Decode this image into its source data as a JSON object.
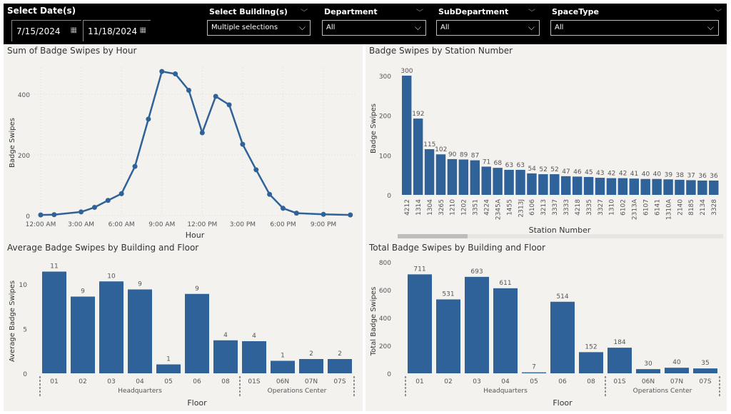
{
  "filters": {
    "date_label": "Select Date(s)",
    "start_date": "7/15/2024",
    "end_date": "11/18/2024",
    "building": {
      "label": "Select Building(s)",
      "value": "Multiple selections"
    },
    "department": {
      "label": "Department",
      "value": "All"
    },
    "subdepartment": {
      "label": "SubDepartment",
      "value": "All"
    },
    "spacetype": {
      "label": "SpaceType",
      "value": "All"
    }
  },
  "colors": {
    "bar": "#2f6298",
    "line": "#2f6298",
    "panel_bg": "#f4f2ee",
    "filter_bg": "#000000"
  },
  "chart_data": [
    {
      "type": "line",
      "title": "Sum of Badge Swipes by Hour",
      "xlabel": "Hour",
      "ylabel": "Badge Swipes",
      "x_ticks": [
        "12:00 AM",
        "3:00 AM",
        "6:00 AM",
        "9:00 AM",
        "12:00 PM",
        "3:00 PM",
        "6:00 PM",
        "9:00 PM"
      ],
      "y_ticks": [
        0,
        200,
        400
      ],
      "ylim": [
        0,
        480
      ],
      "grid": true,
      "x": [
        0,
        1,
        3,
        4,
        5,
        6,
        7,
        8,
        9,
        10,
        11,
        12,
        13,
        14,
        15,
        16,
        17,
        18,
        19,
        21,
        23
      ],
      "values": [
        2,
        3,
        12,
        27,
        50,
        72,
        162,
        318,
        475,
        467,
        413,
        273,
        393,
        365,
        235,
        151,
        70,
        24,
        8,
        4,
        2
      ]
    },
    {
      "type": "bar",
      "title": "Badge Swipes by Station Number",
      "xlabel": "Station Number",
      "ylabel": "Badge Swipes",
      "y_ticks": [
        0,
        100,
        200,
        300
      ],
      "ylim": [
        0,
        310
      ],
      "categories": [
        "4212",
        "1314",
        "1304",
        "3265",
        "1210",
        "1202",
        "3351",
        "4224",
        "2345A",
        "1455",
        "2313J",
        "6106",
        "3213",
        "3337",
        "3333",
        "4218",
        "3335",
        "3327",
        "1310",
        "6102",
        "2313A",
        "6107",
        "6141",
        "1310A",
        "2140",
        "8185",
        "2134",
        "3328"
      ],
      "values": [
        300,
        192,
        115,
        102,
        90,
        89,
        87,
        71,
        68,
        63,
        63,
        54,
        52,
        52,
        47,
        46,
        45,
        43,
        42,
        42,
        41,
        40,
        40,
        39,
        38,
        37,
        36,
        36
      ]
    },
    {
      "type": "bar",
      "title": "Average Badge Swipes by Building and Floor",
      "xlabel": "Floor",
      "ylabel": "Average Badge Swipes",
      "y_ticks": [
        0,
        5,
        10
      ],
      "ylim": [
        0,
        12.5
      ],
      "categories": [
        "01",
        "02",
        "03",
        "04",
        "05",
        "06",
        "08",
        "01S",
        "06N",
        "07N",
        "07S"
      ],
      "groups": [
        {
          "name": "Headquarters",
          "count": 7
        },
        {
          "name": "Operations Center",
          "count": 4
        }
      ],
      "values": [
        11.4,
        8.6,
        10.3,
        9.4,
        1.0,
        8.9,
        3.7,
        3.6,
        1.4,
        1.6,
        1.6
      ],
      "labels": [
        "11",
        "9",
        "10",
        "9",
        "1",
        "9",
        "4",
        "4",
        "1",
        "2",
        "2"
      ]
    },
    {
      "type": "bar",
      "title": "Total Badge Swipes by Building and Floor",
      "xlabel": "Floor",
      "ylabel": "Total Badge Swipes",
      "y_ticks": [
        0,
        200,
        400,
        600,
        800
      ],
      "ylim": [
        0,
        800
      ],
      "categories": [
        "01",
        "02",
        "03",
        "04",
        "05",
        "06",
        "08",
        "01S",
        "06N",
        "07N",
        "07S"
      ],
      "groups": [
        {
          "name": "Headquarters",
          "count": 7
        },
        {
          "name": "Operations Center",
          "count": 4
        }
      ],
      "values": [
        711,
        531,
        693,
        611,
        7,
        514,
        152,
        184,
        30,
        40,
        35
      ],
      "labels": [
        "711",
        "531",
        "693",
        "611",
        "7",
        "514",
        "152",
        "184",
        "30",
        "40",
        "35"
      ]
    }
  ]
}
